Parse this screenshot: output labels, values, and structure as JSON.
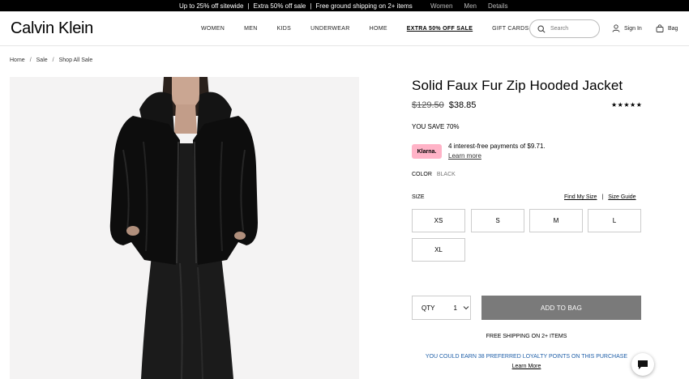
{
  "promo": {
    "messages": [
      "Up to 25% off sitewide",
      "Extra 50% off sale",
      "Free ground shipping on 2+ items"
    ],
    "links": [
      "Women",
      "Men",
      "Details"
    ]
  },
  "header": {
    "logo": "Calvin Klein",
    "nav": [
      "WOMEN",
      "MEN",
      "KIDS",
      "UNDERWEAR",
      "HOME",
      "EXTRA 50% OFF SALE",
      "GIFT CARDS"
    ],
    "search_placeholder": "Search",
    "sign_in": "Sign In",
    "bag": "Bag"
  },
  "breadcrumb": [
    "Home",
    "Sale",
    "Shop All Sale"
  ],
  "product": {
    "title": "Solid Faux Fur Zip Hooded Jacket",
    "original_price": "$129.50",
    "sale_price": "$38.85",
    "rating_stars": "★★★★★",
    "you_save": "YOU SAVE 70%",
    "klarna_badge": "Klarna.",
    "klarna_text": "4 interest-free payments of $9.71.",
    "klarna_learn_more": "Learn more",
    "color_label": "COLOR",
    "color_value": "BLACK",
    "size_label": "SIZE",
    "find_my_size": "Find My Size",
    "size_guide": "Size Guide",
    "sizes": [
      "XS",
      "S",
      "M",
      "L",
      "XL"
    ],
    "qty_label": "QTY",
    "qty_value": "1",
    "add_to_bag": "ADD TO BAG",
    "free_shipping": "FREE SHIPPING ON 2+ ITEMS",
    "loyalty": "YOU COULD EARN 38 PREFERRED LOYALTY POINTS ON THIS PURCHASE",
    "loyalty_learn_more": "Learn More"
  },
  "colors": {
    "promo_bg": "#000000",
    "klarna": "#ffb3c7",
    "add_to_bag_bg": "#7a7a7a",
    "loyalty_text": "#1f5fa8"
  }
}
